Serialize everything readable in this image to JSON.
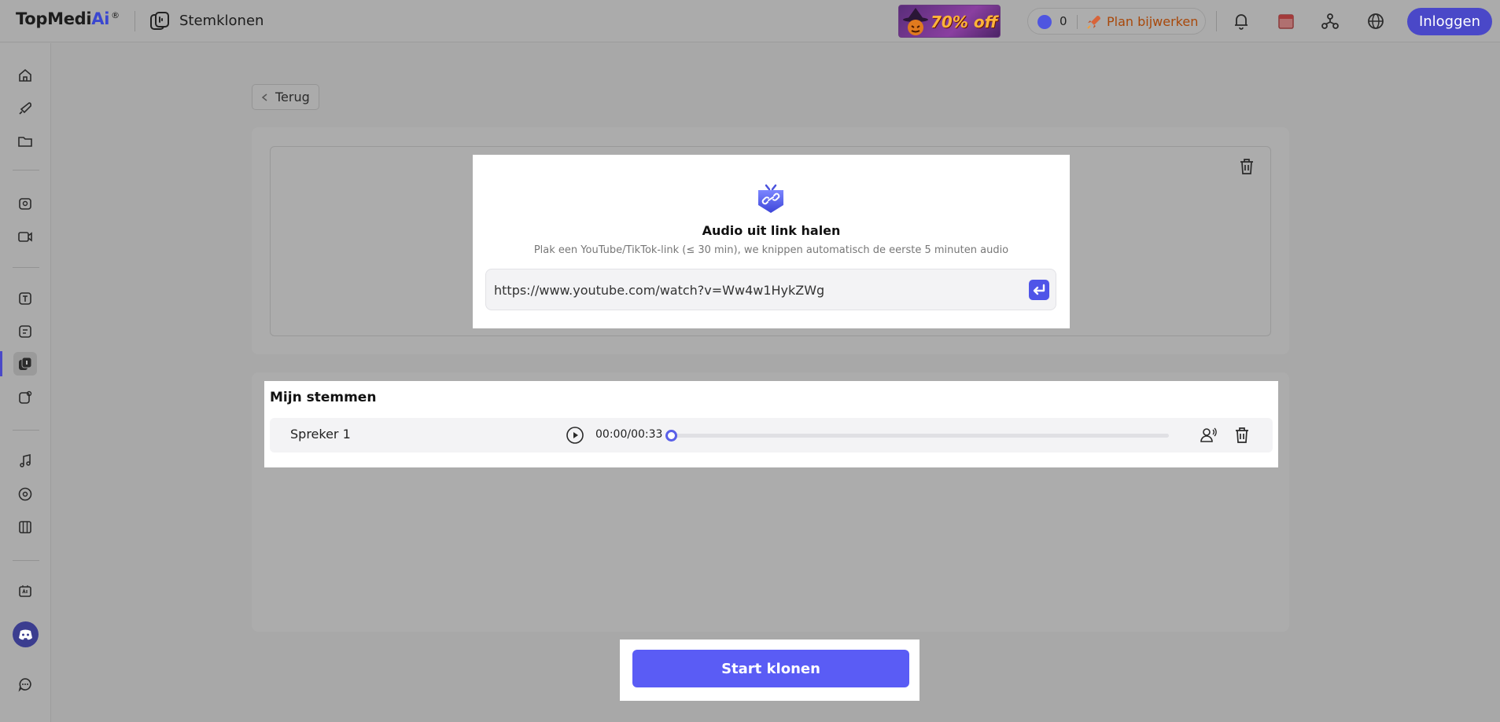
{
  "header": {
    "brand": "TopMedi",
    "brand_ai": "Ai",
    "brand_mark": "®",
    "app_title": "Stemklonen",
    "promo_text": "70% off",
    "credits": "0",
    "plan_label": "Plan bijwerken",
    "login_label": "Inloggen"
  },
  "main": {
    "back_label": "Terug",
    "link_card": {
      "title": "Audio uit link halen",
      "subtitle": "Plak een YouTube/TikTok-link (≤ 30 min), we knippen automatisch de eerste 5 minuten audio",
      "url_value": "https://www.youtube.com/watch?v=Ww4w1HykZWg"
    },
    "voices": {
      "heading": "Mijn stemmen",
      "items": [
        {
          "name": "Spreker 1",
          "time": "00:00/00:33",
          "progress": 0
        }
      ]
    },
    "start_label": "Start klonen"
  },
  "colors": {
    "accent": "#5a5cf5",
    "login_bg": "#4a48c8",
    "plan_text": "#a8480a"
  }
}
